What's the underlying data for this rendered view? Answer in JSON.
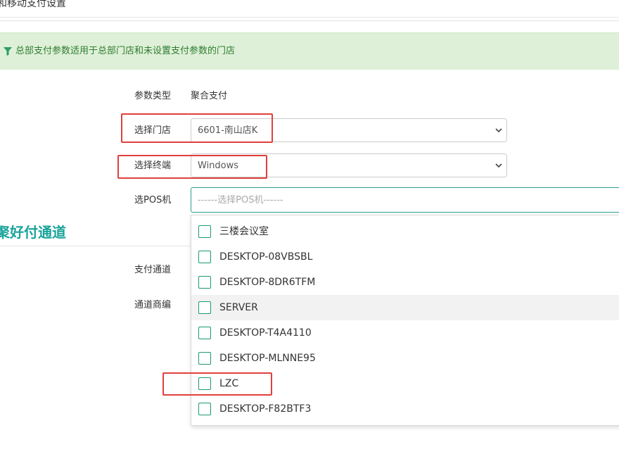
{
  "page": {
    "title": "和移动支付设置"
  },
  "alert": {
    "text": "总部支付参数适用于总部门店和未设置支付参数的门店"
  },
  "form": {
    "param_type_label": "参数类型",
    "param_type_value": "聚合支付",
    "store_label": "选择门店",
    "store_value": "6601-南山店K",
    "terminal_label": "选择终端",
    "terminal_value": "Windows",
    "pos_label": "选POS机",
    "pos_placeholder": "------选择POS机------"
  },
  "section": {
    "title": "聚好付通道",
    "channel_label": "支付通道",
    "merchant_label": "通道商编"
  },
  "pos_dropdown": {
    "items": [
      {
        "label": "三楼会议室",
        "checked": false
      },
      {
        "label": "DESKTOP-08VBSBL",
        "checked": false
      },
      {
        "label": "DESKTOP-8DR6TFM",
        "checked": false
      },
      {
        "label": "SERVER",
        "checked": false,
        "hovered": true
      },
      {
        "label": "DESKTOP-T4A4110",
        "checked": false
      },
      {
        "label": "DESKTOP-MLNNE95",
        "checked": false
      },
      {
        "label": "LZC",
        "checked": false
      },
      {
        "label": "DESKTOP-F82BTF3",
        "checked": false
      }
    ]
  },
  "colors": {
    "accent": "#1aa39a",
    "alert_bg": "#dff0d8",
    "alert_text": "#2e7d32",
    "highlight": "#e0403c",
    "checkbox_border": "#1a9a6e"
  },
  "icons": {
    "alert_icon": "filter-icon",
    "select_icon": "chevron-down-icon"
  }
}
